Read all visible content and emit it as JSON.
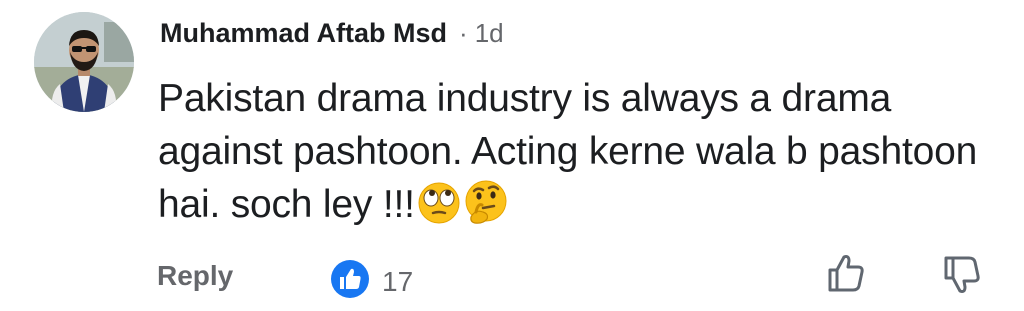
{
  "comment": {
    "author_name": "Muhammad Aftab Msd",
    "separator": "·",
    "time": "1d",
    "text": "Pakistan drama industry is always a drama against pashtoon. Acting kerne wala b pashtoon hai. soch ley !!!",
    "emojis": [
      "face-with-rolling-eyes-icon",
      "thinking-face-icon"
    ]
  },
  "actions": {
    "reply_label": "Reply",
    "like_count": "17",
    "reaction_icon": "like-reaction-icon",
    "like_icon": "thumbs-up-icon",
    "dislike_icon": "thumbs-down-icon"
  },
  "colors": {
    "text_primary": "#1c1e21",
    "text_secondary": "#65676b",
    "reaction_blue": "#1877f2"
  }
}
